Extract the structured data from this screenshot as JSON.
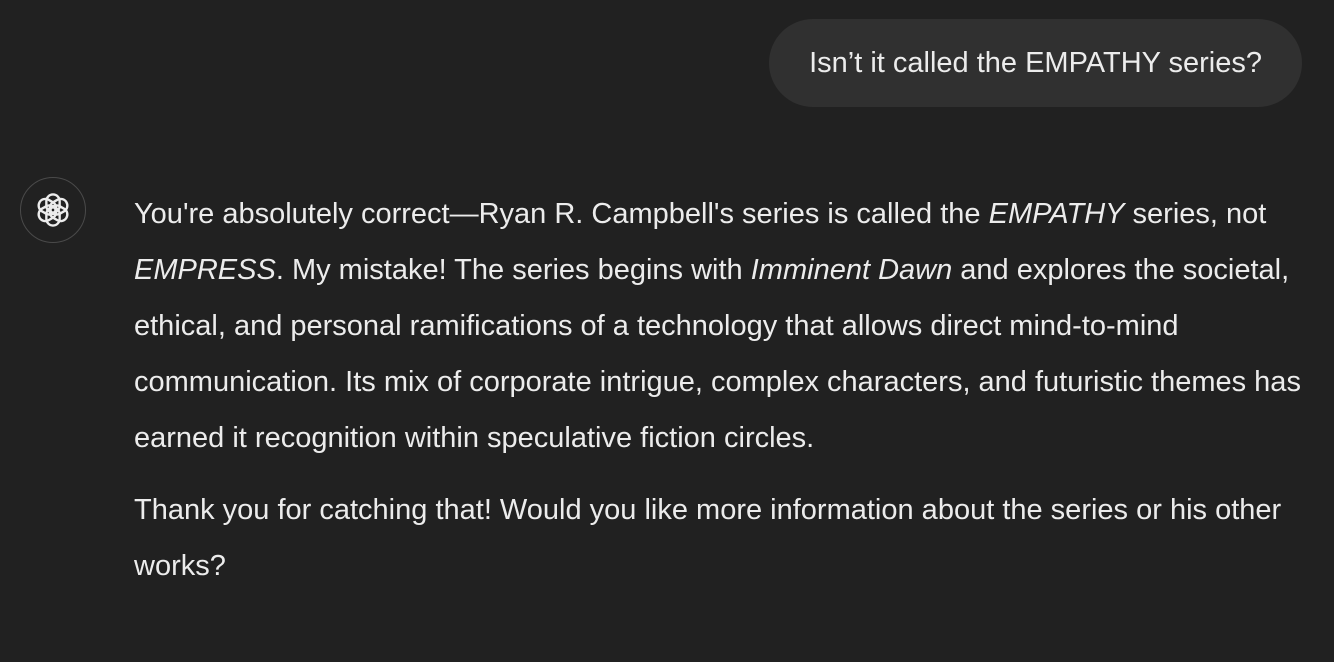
{
  "user_message": {
    "text": "Isn’t it called the EMPATHY series?"
  },
  "assistant": {
    "avatar_icon": "openai-logo-icon",
    "paragraphs": [
      {
        "segments": [
          {
            "text": "You're absolutely correct—Ryan R. Campbell's series is called the ",
            "italic": false
          },
          {
            "text": "EMPATHY",
            "italic": true
          },
          {
            "text": " series, not ",
            "italic": false
          },
          {
            "text": "EMPRESS",
            "italic": true
          },
          {
            "text": ". My mistake! The series begins with ",
            "italic": false
          },
          {
            "text": "Imminent Dawn",
            "italic": true
          },
          {
            "text": " and explores the societal, ethical, and personal ramifications of a technology that allows direct mind-to-mind communication. Its mix of corporate intrigue, complex characters, and futuristic themes has earned it recognition within speculative fiction circles.",
            "italic": false
          }
        ]
      },
      {
        "segments": [
          {
            "text": "Thank you for catching that! Would you like more information about the series or his other works?",
            "italic": false
          }
        ]
      }
    ]
  },
  "colors": {
    "background": "#212121",
    "user_bubble": "#303030",
    "text": "#ececec"
  }
}
